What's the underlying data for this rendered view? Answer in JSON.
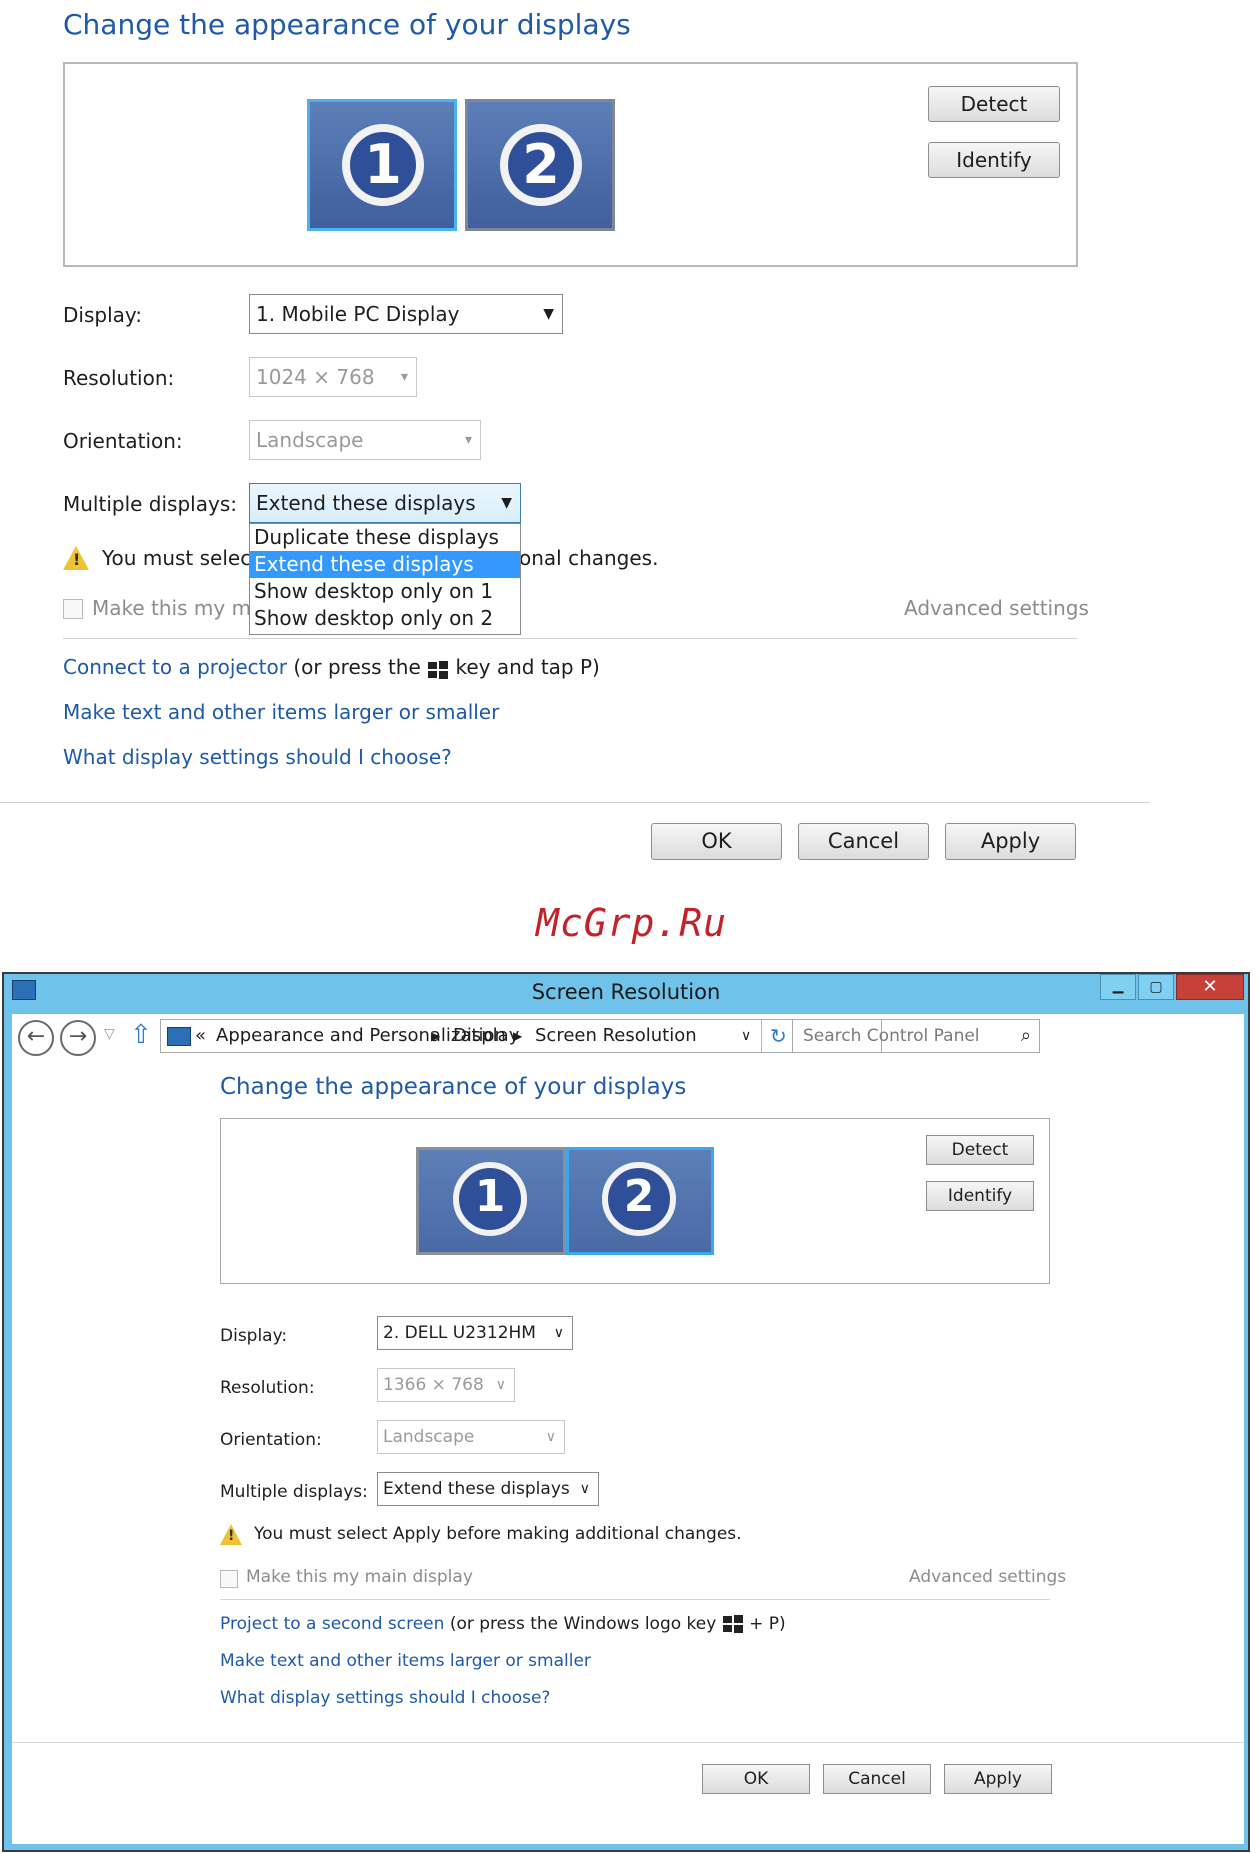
{
  "top": {
    "heading": "Change the appearance of your displays",
    "monitors": [
      "1",
      "2"
    ],
    "detect": "Detect",
    "identify": "Identify",
    "labels": {
      "display": "Display:",
      "resolution": "Resolution:",
      "orientation": "Orientation:",
      "multiple": "Multiple displays:"
    },
    "display_value": "1. Mobile PC Display",
    "resolution_value": "1024 × 768",
    "orientation_value": "Landscape",
    "multiple_value": "Extend these displays",
    "dropdown_options": [
      "Duplicate these displays",
      "Extend these displays",
      "Show desktop only on 1",
      "Show desktop only on 2"
    ],
    "warning_left": "You must select",
    "warning_right": "onal changes.",
    "checkbox_text": "Make this my ma",
    "advanced": "Advanced settings",
    "link_projector": "Connect to a projector",
    "projector_suffix_1": "(or press the",
    "projector_suffix_2": "key and tap P)",
    "link_text_size": "Make text and other items larger or smaller",
    "link_which": "What display settings should I choose?",
    "ok": "OK",
    "cancel": "Cancel",
    "apply": "Apply"
  },
  "watermark": "McGrp.Ru",
  "window": {
    "title": "Screen Resolution",
    "breadcrumb": [
      "Appearance and Personalization",
      "Display",
      "Screen Resolution"
    ],
    "search_placeholder": "Search Control Panel",
    "heading": "Change the appearance of your displays",
    "monitors": [
      "1",
      "2"
    ],
    "detect": "Detect",
    "identify": "Identify",
    "labels": {
      "display": "Display:",
      "resolution": "Resolution:",
      "orientation": "Orientation:",
      "multiple": "Multiple displays:"
    },
    "display_value": "2. DELL U2312HM",
    "resolution_value": "1366 × 768",
    "orientation_value": "Landscape",
    "multiple_value": "Extend these displays",
    "warning": "You must select Apply before making additional changes.",
    "checkbox_text": "Make this my main display",
    "advanced": "Advanced settings",
    "link_project": "Project to a second screen",
    "project_suffix": "(or press the Windows logo key",
    "project_suffix_2": "+ P)",
    "link_text_size": "Make text and other items larger or smaller",
    "link_which": "What display settings should I choose?",
    "ok": "OK",
    "cancel": "Cancel",
    "apply": "Apply"
  },
  "icons": [
    "warning-icon",
    "windows-logo-icon",
    "back-arrow-icon",
    "forward-arrow-icon",
    "up-arrow-icon",
    "refresh-icon",
    "search-icon",
    "minimize-icon",
    "maximize-icon",
    "close-icon",
    "dropdown-arrow-icon"
  ],
  "colors": {
    "link": "#1e5aa8",
    "titlebar": "#6fc3ea",
    "close_button": "#c7403a",
    "selection": "#3399ff"
  }
}
